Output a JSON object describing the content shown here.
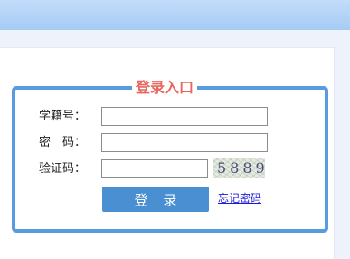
{
  "login": {
    "title": "登录入口",
    "student_id_label": "学籍号：",
    "password_label": "密　码：",
    "captcha_label": "验证码：",
    "student_id_value": "",
    "password_value": "",
    "captcha_value": "",
    "captcha_code": "5889",
    "submit_label": "登 录",
    "forgot_label": "忘记密码"
  },
  "colors": {
    "accent_blue": "#5a9be0",
    "button_blue": "#4a8fd2",
    "title_red": "#e8665e",
    "link_blue": "#1b1bd6"
  }
}
